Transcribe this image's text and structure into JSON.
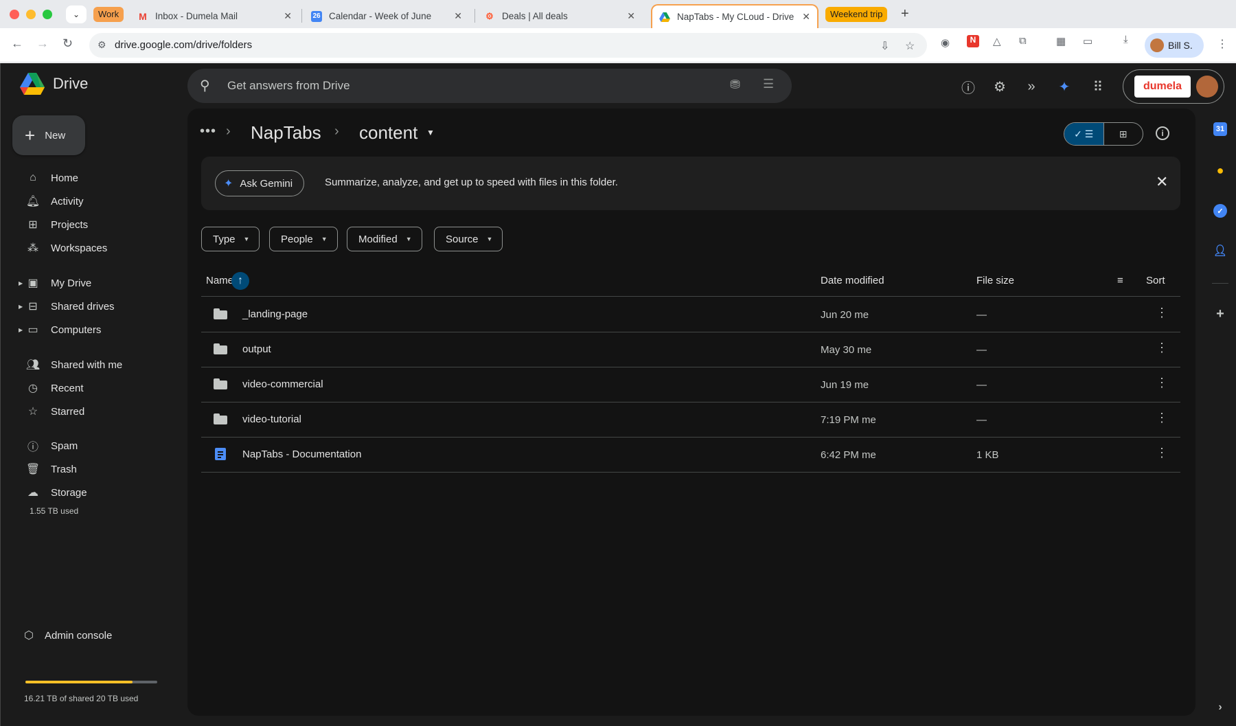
{
  "browser": {
    "tab_groups": {
      "work": "Work",
      "weekend": "Weekend trip"
    },
    "tabs": [
      {
        "title": "Inbox - Dumela Mail",
        "icon": "gmail-icon"
      },
      {
        "title": "Calendar - Week of June",
        "icon": "calendar-icon",
        "badge": "26"
      },
      {
        "title": "Deals | All deals",
        "icon": "hubspot-icon"
      },
      {
        "title": "NapTabs - My CLoud - Drive",
        "icon": "drive-icon",
        "active": true
      }
    ],
    "url": "drive.google.com/drive/folders",
    "profile_name": "Bill S."
  },
  "drive": {
    "app_name": "Drive",
    "search_placeholder": "Get answers from Drive",
    "brand_label": "dumela",
    "new_label": "New",
    "nav": {
      "home": "Home",
      "activity": "Activity",
      "projects": "Projects",
      "workspaces": "Workspaces",
      "my_drive": "My Drive",
      "shared_drives": "Shared drives",
      "computers": "Computers",
      "shared_with_me": "Shared with me",
      "recent": "Recent",
      "starred": "Starred",
      "spam": "Spam",
      "trash": "Trash",
      "storage": "Storage"
    },
    "storage_used": "1.55 TB used",
    "admin_console": "Admin console",
    "quota_text": "16.21 TB of shared 20 TB used",
    "quota_fraction": 0.81,
    "breadcrumb": {
      "parent": "NapTabs",
      "current": "content"
    },
    "gemini": {
      "button": "Ask Gemini",
      "text": "Summarize, analyze, and get up to speed with files in this folder."
    },
    "filters": [
      "Type",
      "People",
      "Modified",
      "Source"
    ],
    "columns": {
      "name": "Name",
      "date": "Date modified",
      "size": "File size",
      "sort": "Sort"
    },
    "files": [
      {
        "name": "_landing-page",
        "date": "Jun 20 me",
        "size": "—",
        "kind": "folder"
      },
      {
        "name": "output",
        "date": "May 30 me",
        "size": "—",
        "kind": "folder"
      },
      {
        "name": "video-commercial",
        "date": "Jun 19 me",
        "size": "—",
        "kind": "folder"
      },
      {
        "name": "video-tutorial",
        "date": "7:19 PM me",
        "size": "—",
        "kind": "folder"
      },
      {
        "name": "NapTabs - Documentation",
        "date": "6:42 PM me",
        "size": "1 KB",
        "kind": "doc"
      }
    ]
  },
  "colors": {
    "accent": "#004a77",
    "background": "#1b1b1b",
    "panel": "#131313",
    "quota": "#f6bf26",
    "tab_group_work": "#f6a04d",
    "tab_group_weekend": "#f9ab00"
  }
}
